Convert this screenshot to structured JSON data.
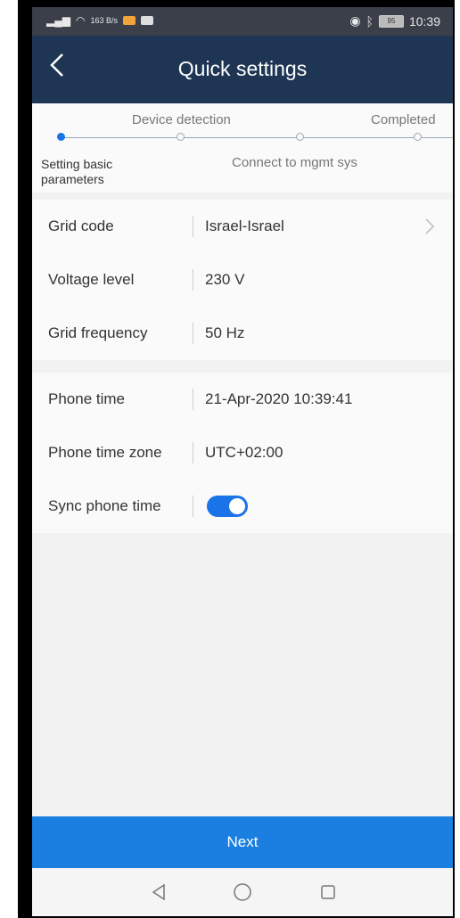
{
  "status_bar": {
    "left_text": "163 B/s",
    "time": "10:39",
    "battery": "95"
  },
  "app_bar": {
    "title": "Quick settings",
    "back_icon": "back-chevron-icon"
  },
  "stepper": {
    "steps": [
      {
        "label": "Setting basic parameters",
        "state": "active"
      },
      {
        "label": "Device detection",
        "state": "pending"
      },
      {
        "label": "Connect to mgmt sys",
        "state": "pending"
      },
      {
        "label": "Completed",
        "state": "pending"
      }
    ]
  },
  "grid_settings": {
    "rows": [
      {
        "label": "Grid code",
        "value": "Israel-Israel"
      },
      {
        "label": "Voltage level",
        "value": "230 V"
      },
      {
        "label": "Grid frequency",
        "value": "50 Hz"
      }
    ]
  },
  "time_settings": {
    "rows": [
      {
        "label": "Phone time",
        "value": "21-Apr-2020 10:39:41"
      },
      {
        "label": "Phone time zone",
        "value": "UTC+02:00"
      },
      {
        "label": "Sync phone time",
        "value": "on"
      }
    ]
  },
  "footer": {
    "next_label": "Next"
  },
  "colors": {
    "app_bar": "#1e3554",
    "accent": "#1a73e8",
    "next_button": "#1a7fe0"
  }
}
